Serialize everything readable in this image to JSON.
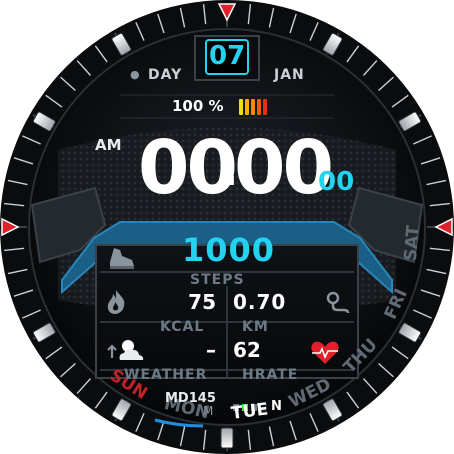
{
  "date": {
    "day_number": "07",
    "day_label": "DAY",
    "month": "JAN"
  },
  "battery": {
    "percent_text": "100 %",
    "level": 1.0,
    "bar_colors": [
      "#f0e010",
      "#f5b000",
      "#f58a00",
      "#f05a00",
      "#e83010"
    ]
  },
  "time": {
    "ampm": "AM",
    "hours": "00",
    "colon": ":",
    "minutes": "00",
    "seconds": "00"
  },
  "steps": {
    "value": "1000",
    "label": "STEPS",
    "icon": "shoe-icon"
  },
  "calories": {
    "value": "75",
    "label": "KCAL",
    "icon": "flame-icon"
  },
  "distance": {
    "value": "0.70",
    "label": "KM",
    "icon": "route-icon"
  },
  "weather": {
    "value": "–",
    "label": "WEATHER",
    "icon": "partly-cloudy-icon"
  },
  "heart_rate": {
    "value": "62",
    "label": "HRATE",
    "icon": "heart-pulse-icon"
  },
  "weekdays": {
    "items": [
      "SUN",
      "MON",
      "TUE",
      "WED",
      "THU",
      "FRI",
      "SAT"
    ],
    "active": "TUE",
    "colors": {
      "sun": "#c0222a",
      "active": "#ffffff",
      "inactive": "#5f6a74",
      "underline": "#1e8fe0"
    }
  },
  "brand": {
    "model": "MD145",
    "logo_letter": "M",
    "status_letter": "N"
  },
  "colors": {
    "accent": "#23d3f0",
    "panel_border": "#1f6e9a",
    "marker_red": "#e0202a",
    "heart": "#e0202a"
  }
}
